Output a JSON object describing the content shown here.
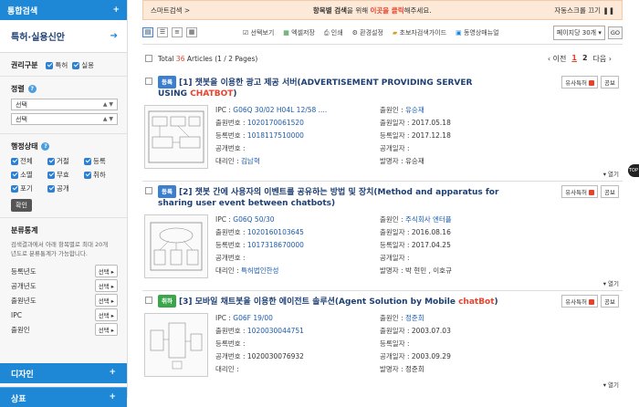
{
  "sidebar": {
    "top_label": "통합검색",
    "title": "특허·실용신안",
    "rights": {
      "heading": "권리구분",
      "options": [
        "특허",
        "실용"
      ]
    },
    "sort": {
      "heading": "정렬",
      "select1": "선택",
      "select2": "선택"
    },
    "status": {
      "heading": "행정상태",
      "options": [
        "전체",
        "거절",
        "등록",
        "소멸",
        "무효",
        "취하",
        "포기",
        "공개"
      ],
      "confirm": "확인"
    },
    "stats": {
      "heading": "분류통계",
      "desc_line1": "검색결과에서 아래 항목별로 최대 20개",
      "desc_line2": "년도로 분류통계가 가능합니다.",
      "rows": [
        "등록년도",
        "공개년도",
        "출원년도",
        "IPC",
        "출원인"
      ],
      "select_label": "선택"
    },
    "bottom1": "디자인",
    "bottom2": "상표"
  },
  "banner": {
    "left": "스마트검색 >",
    "mid_pre": "항목별 검색",
    "mid_text": "을 위해 ",
    "mid_link": "이곳을 클릭",
    "mid_post": "해주세요.",
    "right": "자동스크롤 끄기"
  },
  "toolbar": {
    "tools": [
      "선택보기",
      "엑셀저장",
      "인쇄",
      "환경설정",
      "초보자검색가이드",
      "동영상매뉴얼"
    ],
    "per_page": "페이지당 30개",
    "go": "GO"
  },
  "summary": {
    "total_label": "Total",
    "count": "36",
    "articles": "Articles (1 / 2 Pages)",
    "prev": "‹ 이전",
    "page1": "1",
    "page2": "2",
    "next": "다음 ›"
  },
  "results": [
    {
      "badge": "등록",
      "num": "[1]",
      "title_pre": "챗봇을 이용한 광고 제공 서버(ADVERTISEMENT PROVIDING SERVER USING ",
      "title_kw": "CHATBOT",
      "title_post": ")",
      "ipc_label": "IPC :",
      "ipc": "G06Q 30/02   H04L 12/58   ....",
      "app_no_label": "출원번호 :",
      "app_no": "1020170061520",
      "reg_no_label": "등록번호 :",
      "reg_no": "1018117510000",
      "pub_no_label": "공개번호 :",
      "pub_no": "",
      "agent_label": "대리인 :",
      "agent": "김남혁",
      "applicant_label": "출원인 :",
      "applicant": "유승재",
      "app_date_label": "출원일자 :",
      "app_date": "2017.05.18",
      "reg_date_label": "등록일자 :",
      "reg_date": "2017.12.18",
      "pub_date_label": "공개일자 :",
      "pub_date": "",
      "inventor_label": "발명자 :",
      "inventor": "유승재"
    },
    {
      "badge": "등록",
      "num": "[2]",
      "title_pre": "챗봇 간에 사용자의 이벤트를 공유하는 방법 및 장치(Method and apparatus for sharing user event between chatbots)",
      "title_kw": "",
      "title_post": "",
      "ipc_label": "IPC :",
      "ipc": "G06Q 50/30",
      "app_no_label": "출원번호 :",
      "app_no": "1020160103645",
      "reg_no_label": "등록번호 :",
      "reg_no": "1017318670000",
      "pub_no_label": "공개번호 :",
      "pub_no": "",
      "agent_label": "대리인 :",
      "agent": "특허법인한성",
      "applicant_label": "출원인 :",
      "applicant": "주식회사 엔터플",
      "app_date_label": "출원일자 :",
      "app_date": "2016.08.16",
      "reg_date_label": "등록일자 :",
      "reg_date": "2017.04.25",
      "pub_date_label": "공개일자 :",
      "pub_date": "",
      "inventor_label": "발명자 :",
      "inventor": "박 현민 , 이호규"
    },
    {
      "badge": "취하",
      "num": "[3]",
      "title_pre": "모바일 채트봇을 이용한 에이전트 솔루션(Agent Solution by Mobile ",
      "title_kw": "chatBot",
      "title_post": ")",
      "ipc_label": "IPC :",
      "ipc": "G06F 19/00",
      "app_no_label": "출원번호 :",
      "app_no": "1020030044751",
      "reg_no_label": "등록번호 :",
      "reg_no": "",
      "pub_no_label": "공개번호 :",
      "pub_no": "1020030076932",
      "agent_label": "대리인 :",
      "agent": "",
      "applicant_label": "출원인 :",
      "applicant": "정준희",
      "app_date_label": "출원일자 :",
      "app_date": "2003.07.03",
      "reg_date_label": "등록일자 :",
      "reg_date": "",
      "pub_date_label": "공개일자 :",
      "pub_date": "2003.09.29",
      "inventor_label": "발명자 :",
      "inventor": "정준희"
    }
  ],
  "item_actions": {
    "similar": "유사특허",
    "share": "공보",
    "more": "열기"
  },
  "side_float": "TOP"
}
